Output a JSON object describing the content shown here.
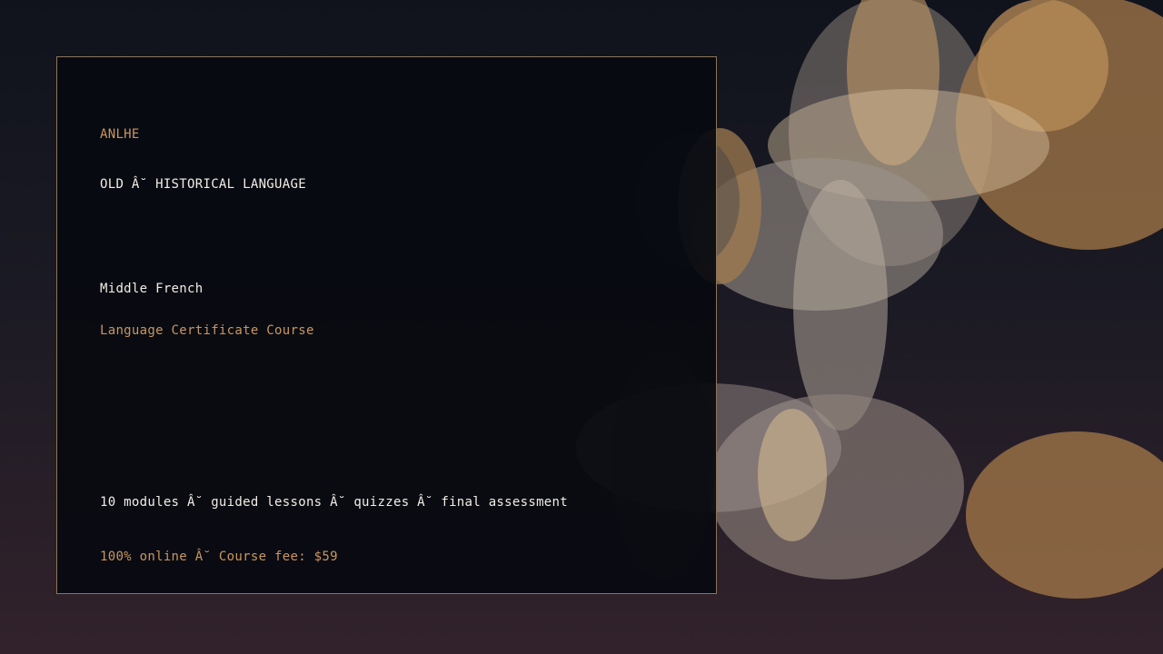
{
  "brand": "ANLHE",
  "category": "OLD Â˘ HISTORICAL LANGUAGE",
  "course": {
    "name": "Middle French",
    "type": "Language Certificate Course"
  },
  "details": {
    "features": "10 modules Â˘ guided lessons Â˘ quizzes Â˘ final assessment",
    "pricing": "100% online Â˘ Course fee: $59"
  },
  "colors": {
    "accent": "#c9965f",
    "text": "#f2ede6",
    "panel_border": "#8c7558",
    "background_top": "#10131c",
    "background_bottom": "#32222b"
  }
}
